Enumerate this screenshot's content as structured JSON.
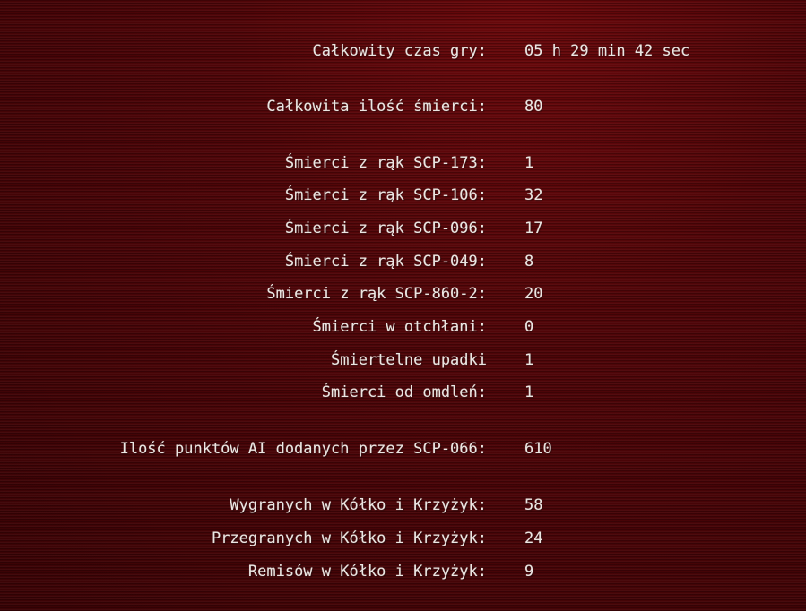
{
  "stats": {
    "total_time": {
      "label": "Całkowity czas gry:",
      "value": "05 h 29 min 42 sec"
    },
    "total_deaths": {
      "label": "Całkowita ilość śmierci:",
      "value": "80"
    },
    "deaths_scp173": {
      "label": "Śmierci z rąk SCP-173:",
      "value": "1"
    },
    "deaths_scp106": {
      "label": "Śmierci z rąk SCP-106:",
      "value": "32"
    },
    "deaths_scp096": {
      "label": "Śmierci z rąk SCP-096:",
      "value": "17"
    },
    "deaths_scp049": {
      "label": "Śmierci z rąk SCP-049:",
      "value": "8"
    },
    "deaths_scp860_2": {
      "label": "Śmierci z rąk SCP-860-2:",
      "value": "20"
    },
    "deaths_abyss": {
      "label": "Śmierci w otchłani:",
      "value": "0"
    },
    "deaths_falls": {
      "label": "Śmiertelne upadki",
      "value": "1"
    },
    "deaths_fainting": {
      "label": "Śmierci od omdleń:",
      "value": "1"
    },
    "scp066_ai_points": {
      "label": "Ilość punktów AI dodanych przez SCP-066:",
      "value": "610"
    },
    "ttt_wins": {
      "label": "Wygranych w Kółko i Krzyżyk:",
      "value": "58"
    },
    "ttt_losses": {
      "label": "Przegranych w Kółko i Krzyżyk:",
      "value": "24"
    },
    "ttt_draws": {
      "label": "Remisów w Kółko i Krzyżyk:",
      "value": "9"
    }
  }
}
